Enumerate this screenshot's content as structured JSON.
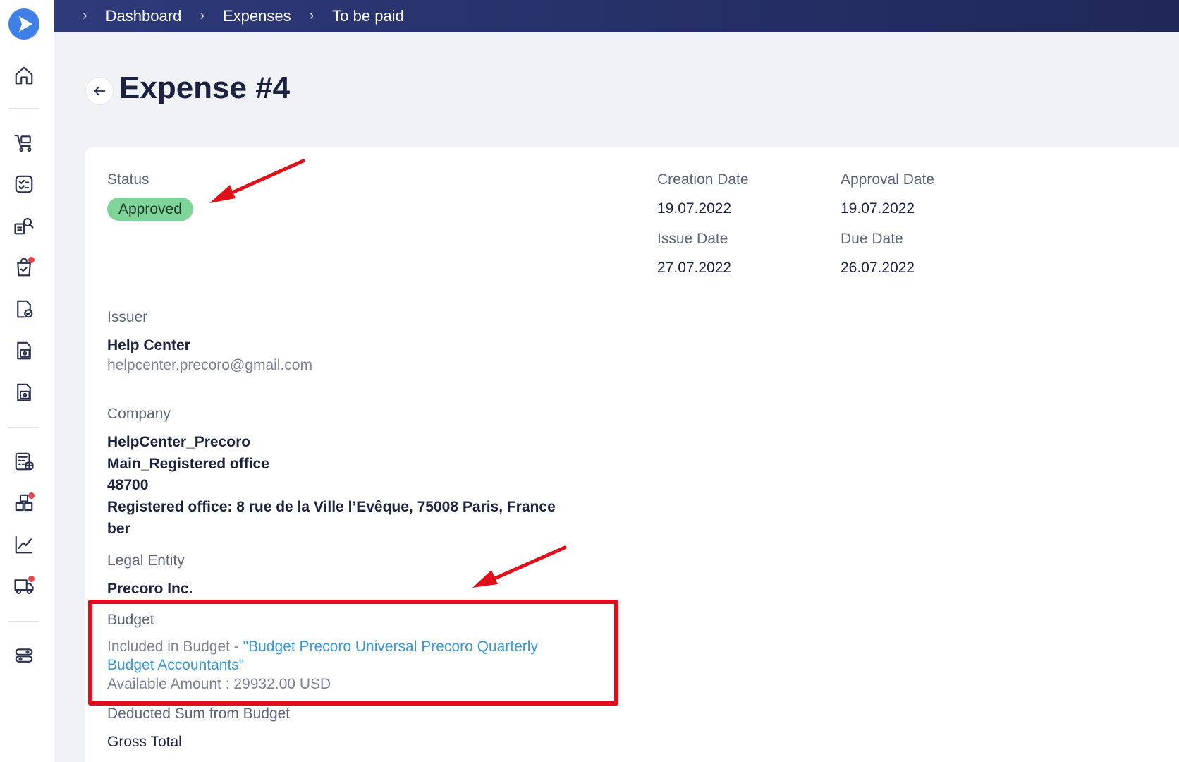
{
  "breadcrumb": {
    "items": [
      "Dashboard",
      "Expenses",
      "To be paid"
    ],
    "separator": "›"
  },
  "page": {
    "title": "Expense #4"
  },
  "details": {
    "status_label": "Status",
    "status_value": "Approved",
    "creation_date_label": "Creation Date",
    "creation_date_value": "19.07.2022",
    "approval_date_label": "Approval Date",
    "approval_date_value": "19.07.2022",
    "issue_date_label": "Issue Date",
    "issue_date_value": "27.07.2022",
    "due_date_label": "Due Date",
    "due_date_value": "26.07.2022"
  },
  "issuer": {
    "label": "Issuer",
    "name": "Help Center",
    "email": "helpcenter.precoro@gmail.com"
  },
  "company": {
    "label": "Company",
    "name": "HelpCenter_Precoro",
    "office": "Main_Registered office",
    "code": "48700",
    "address": "Registered office: 8 rue de la Ville l’Evêque, 75008 Paris, France",
    "extra": "ber"
  },
  "legal_entity": {
    "label": "Legal Entity",
    "value": "Precoro Inc."
  },
  "budget": {
    "label": "Budget",
    "included_prefix": "Included in Budget - ",
    "budget_name_line1": "\"Budget Precoro Universal Precoro Quarterly",
    "budget_name_line2": "Budget Accountants\"",
    "available": "Available Amount : 29932.00 USD"
  },
  "deducted": {
    "label": "Deducted Sum from Budget",
    "value": "Gross Total"
  },
  "colors": {
    "topbar": "#2e3a7a",
    "badge": "#7fd49a",
    "link": "#3a9ad9",
    "annotation": "#e0101b"
  }
}
